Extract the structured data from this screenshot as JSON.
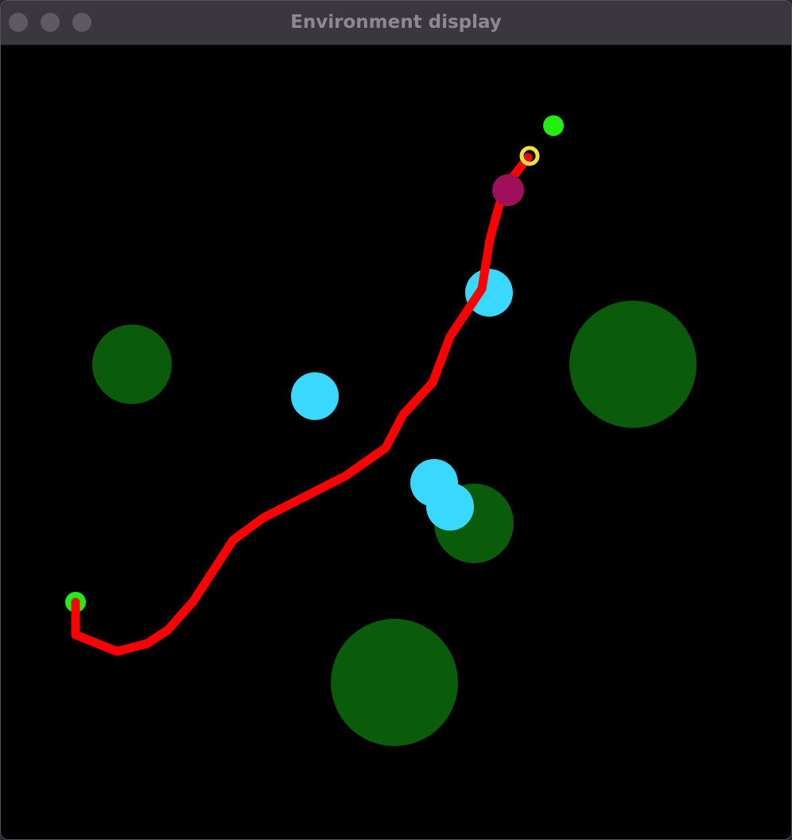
{
  "window": {
    "title": "Environment display",
    "controls": [
      "close-button",
      "minimize-button",
      "zoom-button"
    ]
  },
  "colors": {
    "background": "#000000",
    "titlebar": "#3a383e",
    "title_text": "#8c8a90",
    "obstacle_large": "#0a5c0a",
    "obstacle_small": "#38d8ff",
    "path": "#ff0000",
    "start_marker": "#22ee11",
    "goal_marker": "#22ee11",
    "target_ring": "#f0e040",
    "agent": "#a0105a"
  },
  "scene": {
    "elements": [
      "green-obstacle",
      "green-obstacle",
      "green-obstacle",
      "green-obstacle",
      "cyan-obstacle",
      "cyan-obstacle",
      "cyan-obstacle",
      "cyan-obstacle",
      "red-trajectory",
      "start-marker",
      "goal-marker",
      "target-ring",
      "agent-marker"
    ]
  }
}
